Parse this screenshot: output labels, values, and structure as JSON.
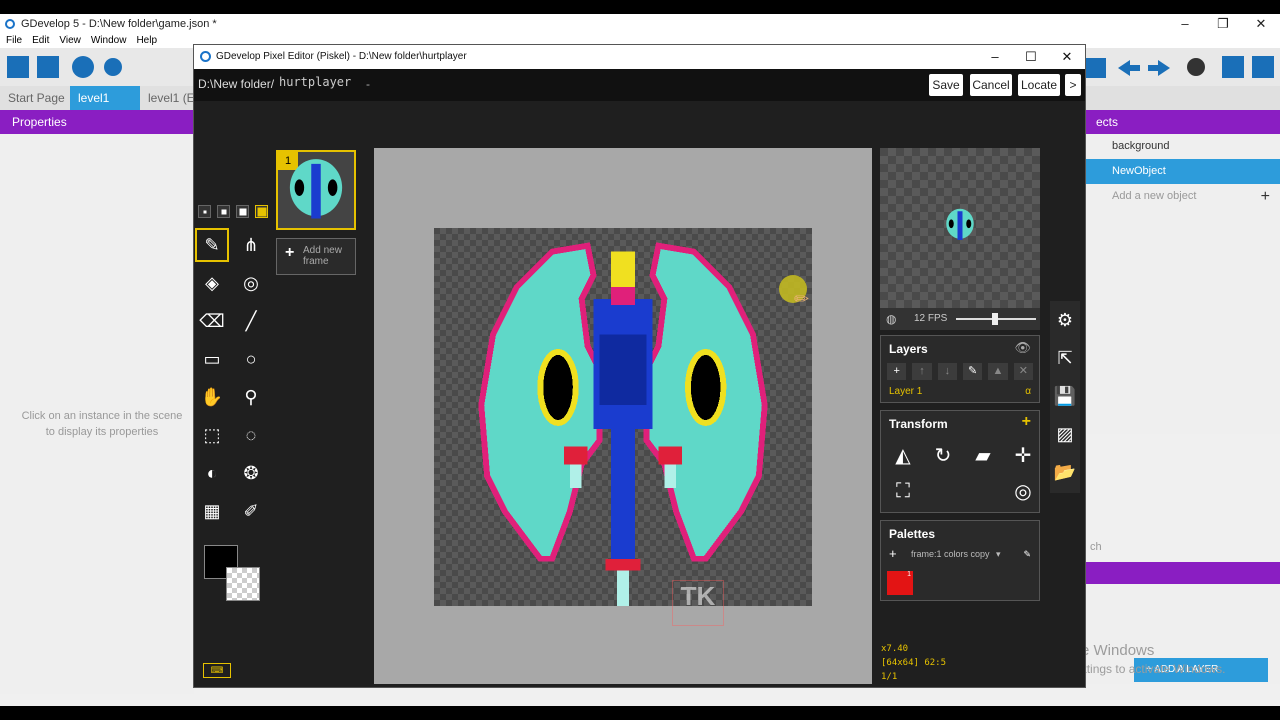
{
  "main_window": {
    "title": "GDevelop 5 - D:\\New folder\\game.json *",
    "menu": [
      "File",
      "Edit",
      "View",
      "Window",
      "Help"
    ],
    "tabs": [
      "Start Page",
      "level1",
      "level1 (E"
    ],
    "properties_label": "Properties",
    "properties_hint": "Click on an instance in the scene to display its properties",
    "objects_label": "ects",
    "objects": [
      "background",
      "NewObject"
    ],
    "add_object_label": "Add a new object",
    "search_placeholder": "ch",
    "add_window_label": "+ ADD A LAYER"
  },
  "windows_activation": {
    "line1": "Activate Windows",
    "line2": "Go to Settings to activate Windows."
  },
  "piskel": {
    "title": "GDevelop Pixel Editor (Piskel) - D:\\New folder\\hurtplayer",
    "path": "D:\\New folder/",
    "filename": "hurtplayer",
    "dash": "-",
    "buttons": {
      "save": "Save",
      "cancel": "Cancel",
      "locate": "Locate",
      "next": ">"
    },
    "frame_number": "1",
    "add_frame_label": "Add new frame",
    "fps_label": "12 FPS",
    "layers_title": "Layers",
    "layer_name": "Layer 1",
    "layer_alpha": "α",
    "transform_title": "Transform",
    "palettes_title": "Palettes",
    "palette_name": "frame:1 colors copy",
    "palette_count": "1",
    "status": {
      "zoom": "x7.40",
      "size_cursor": "[64x64] 62:5",
      "frame": "1/1"
    },
    "watermark": "TK"
  },
  "colors": {
    "accent": "#e6c200",
    "purple": "#8a1ec2",
    "blue": "#2d9cdb",
    "palette_red": "#e31414"
  }
}
